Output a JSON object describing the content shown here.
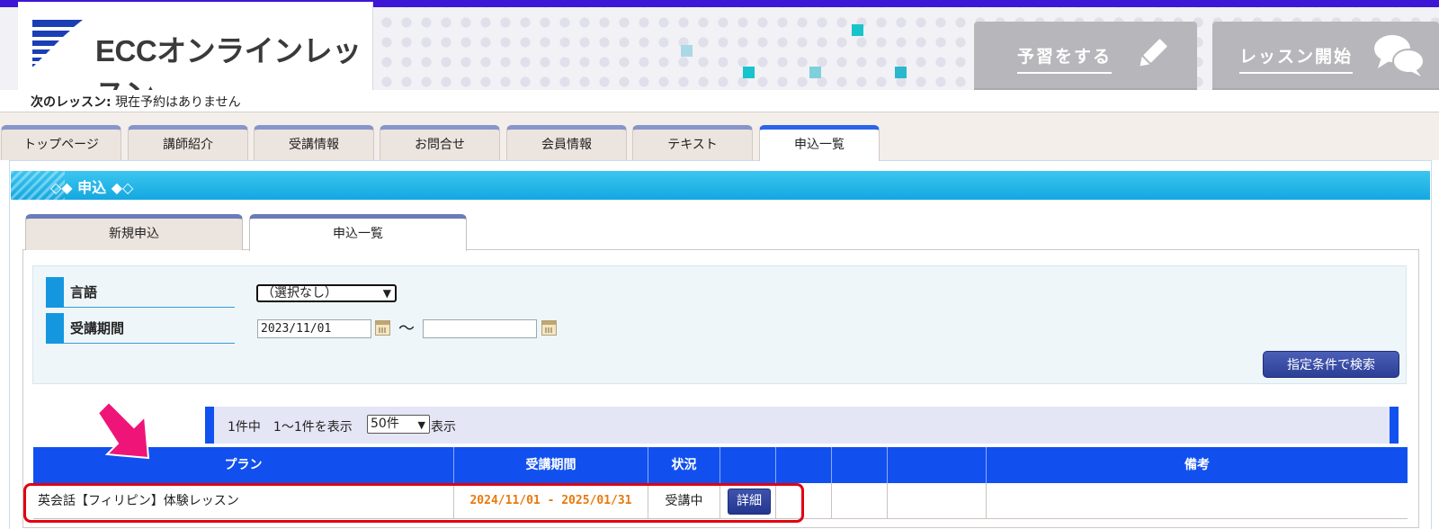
{
  "header": {
    "logo_text": "ECCオンラインレッスン",
    "preview_button": "予習をする",
    "start_button": "レッスン開始"
  },
  "next_lesson": {
    "label": "次のレッスン:",
    "value": "現在予約はありません"
  },
  "nav": {
    "tabs": [
      {
        "label": "トップページ"
      },
      {
        "label": "講師紹介"
      },
      {
        "label": "受講情報"
      },
      {
        "label": "お問合せ"
      },
      {
        "label": "会員情報"
      },
      {
        "label": "テキスト"
      },
      {
        "label": "申込一覧",
        "active": true
      }
    ]
  },
  "section": {
    "title": "◇◆ 申込 ◆◇"
  },
  "sub_tabs": [
    {
      "label": "新規申込"
    },
    {
      "label": "申込一覧",
      "active": true
    }
  ],
  "filters": {
    "language_label": "言語",
    "language_value": "（選択なし）",
    "period_label": "受講期間",
    "date_from": "2023/11/01",
    "date_to": "",
    "tilde": "～",
    "search_button": "指定条件で検索"
  },
  "results": {
    "count_text": "1件中　1〜1件を表示",
    "per_page": "50件",
    "per_page_suffix": "表示"
  },
  "table": {
    "headers": [
      "プラン",
      "受講期間",
      "状況",
      "",
      "",
      "",
      "",
      "備考"
    ],
    "rows": [
      {
        "plan": "英会話【フィリピン】体験レッスン",
        "period": "2024/11/01 - 2025/01/31",
        "status": "受講中",
        "detail_button": "詳細",
        "remarks": ""
      }
    ]
  },
  "colors": {
    "header_accent": "#3d16d6",
    "table_header": "#1150ef",
    "period_text": "#e8790c",
    "annotation_red": "#e10010",
    "annotation_arrow": "#f0167a"
  }
}
